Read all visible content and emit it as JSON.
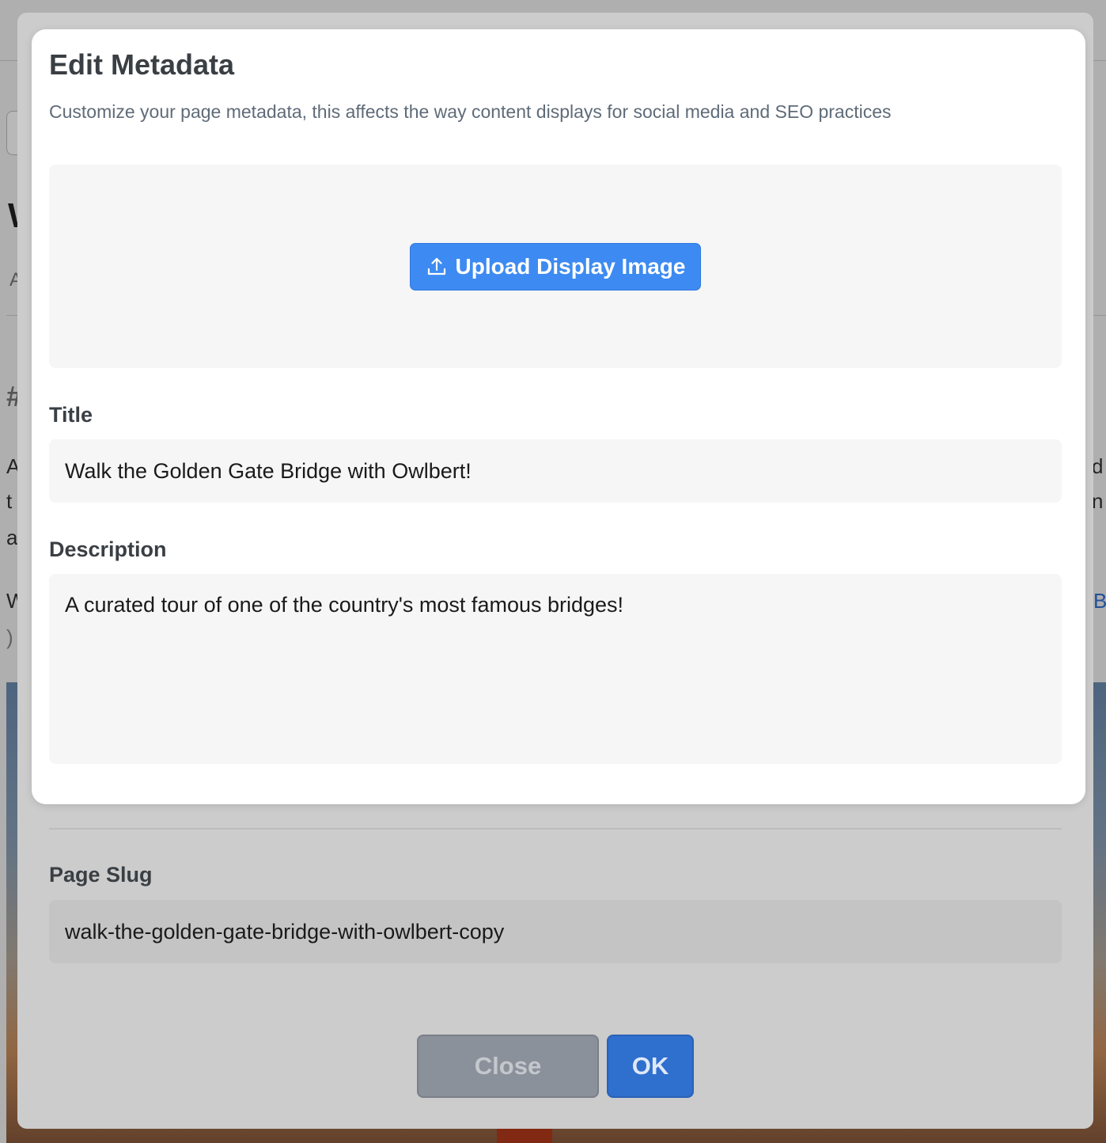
{
  "modal": {
    "title": "Edit Metadata",
    "subtitle": "Customize your page metadata, this affects the way content displays for social media and SEO practices",
    "upload_button_label": "Upload Display Image",
    "upload_icon": "upload-icon",
    "title_label": "Title",
    "title_value": "Walk the Golden Gate Bridge with Owlbert!",
    "description_label": "Description",
    "description_value": "A curated tour of one of the country's most famous bridges!"
  },
  "outer_dialog": {
    "page_slug_label": "Page Slug",
    "page_slug_value": "walk-the-golden-gate-bridge-with-owlbert-copy",
    "close_label": "Close",
    "ok_label": "OK"
  },
  "background_page": {
    "fragments": [
      "A",
      "t",
      "a",
      "W",
      ")",
      "d",
      "n",
      "B",
      "#"
    ]
  },
  "colors": {
    "primary_button": "#3d8bf2",
    "ok_button": "#2f6fce",
    "close_button": "#8b919b",
    "heading_text": "#3a3f44",
    "subtitle_text": "#5f6b78",
    "field_background": "#f6f6f6"
  }
}
